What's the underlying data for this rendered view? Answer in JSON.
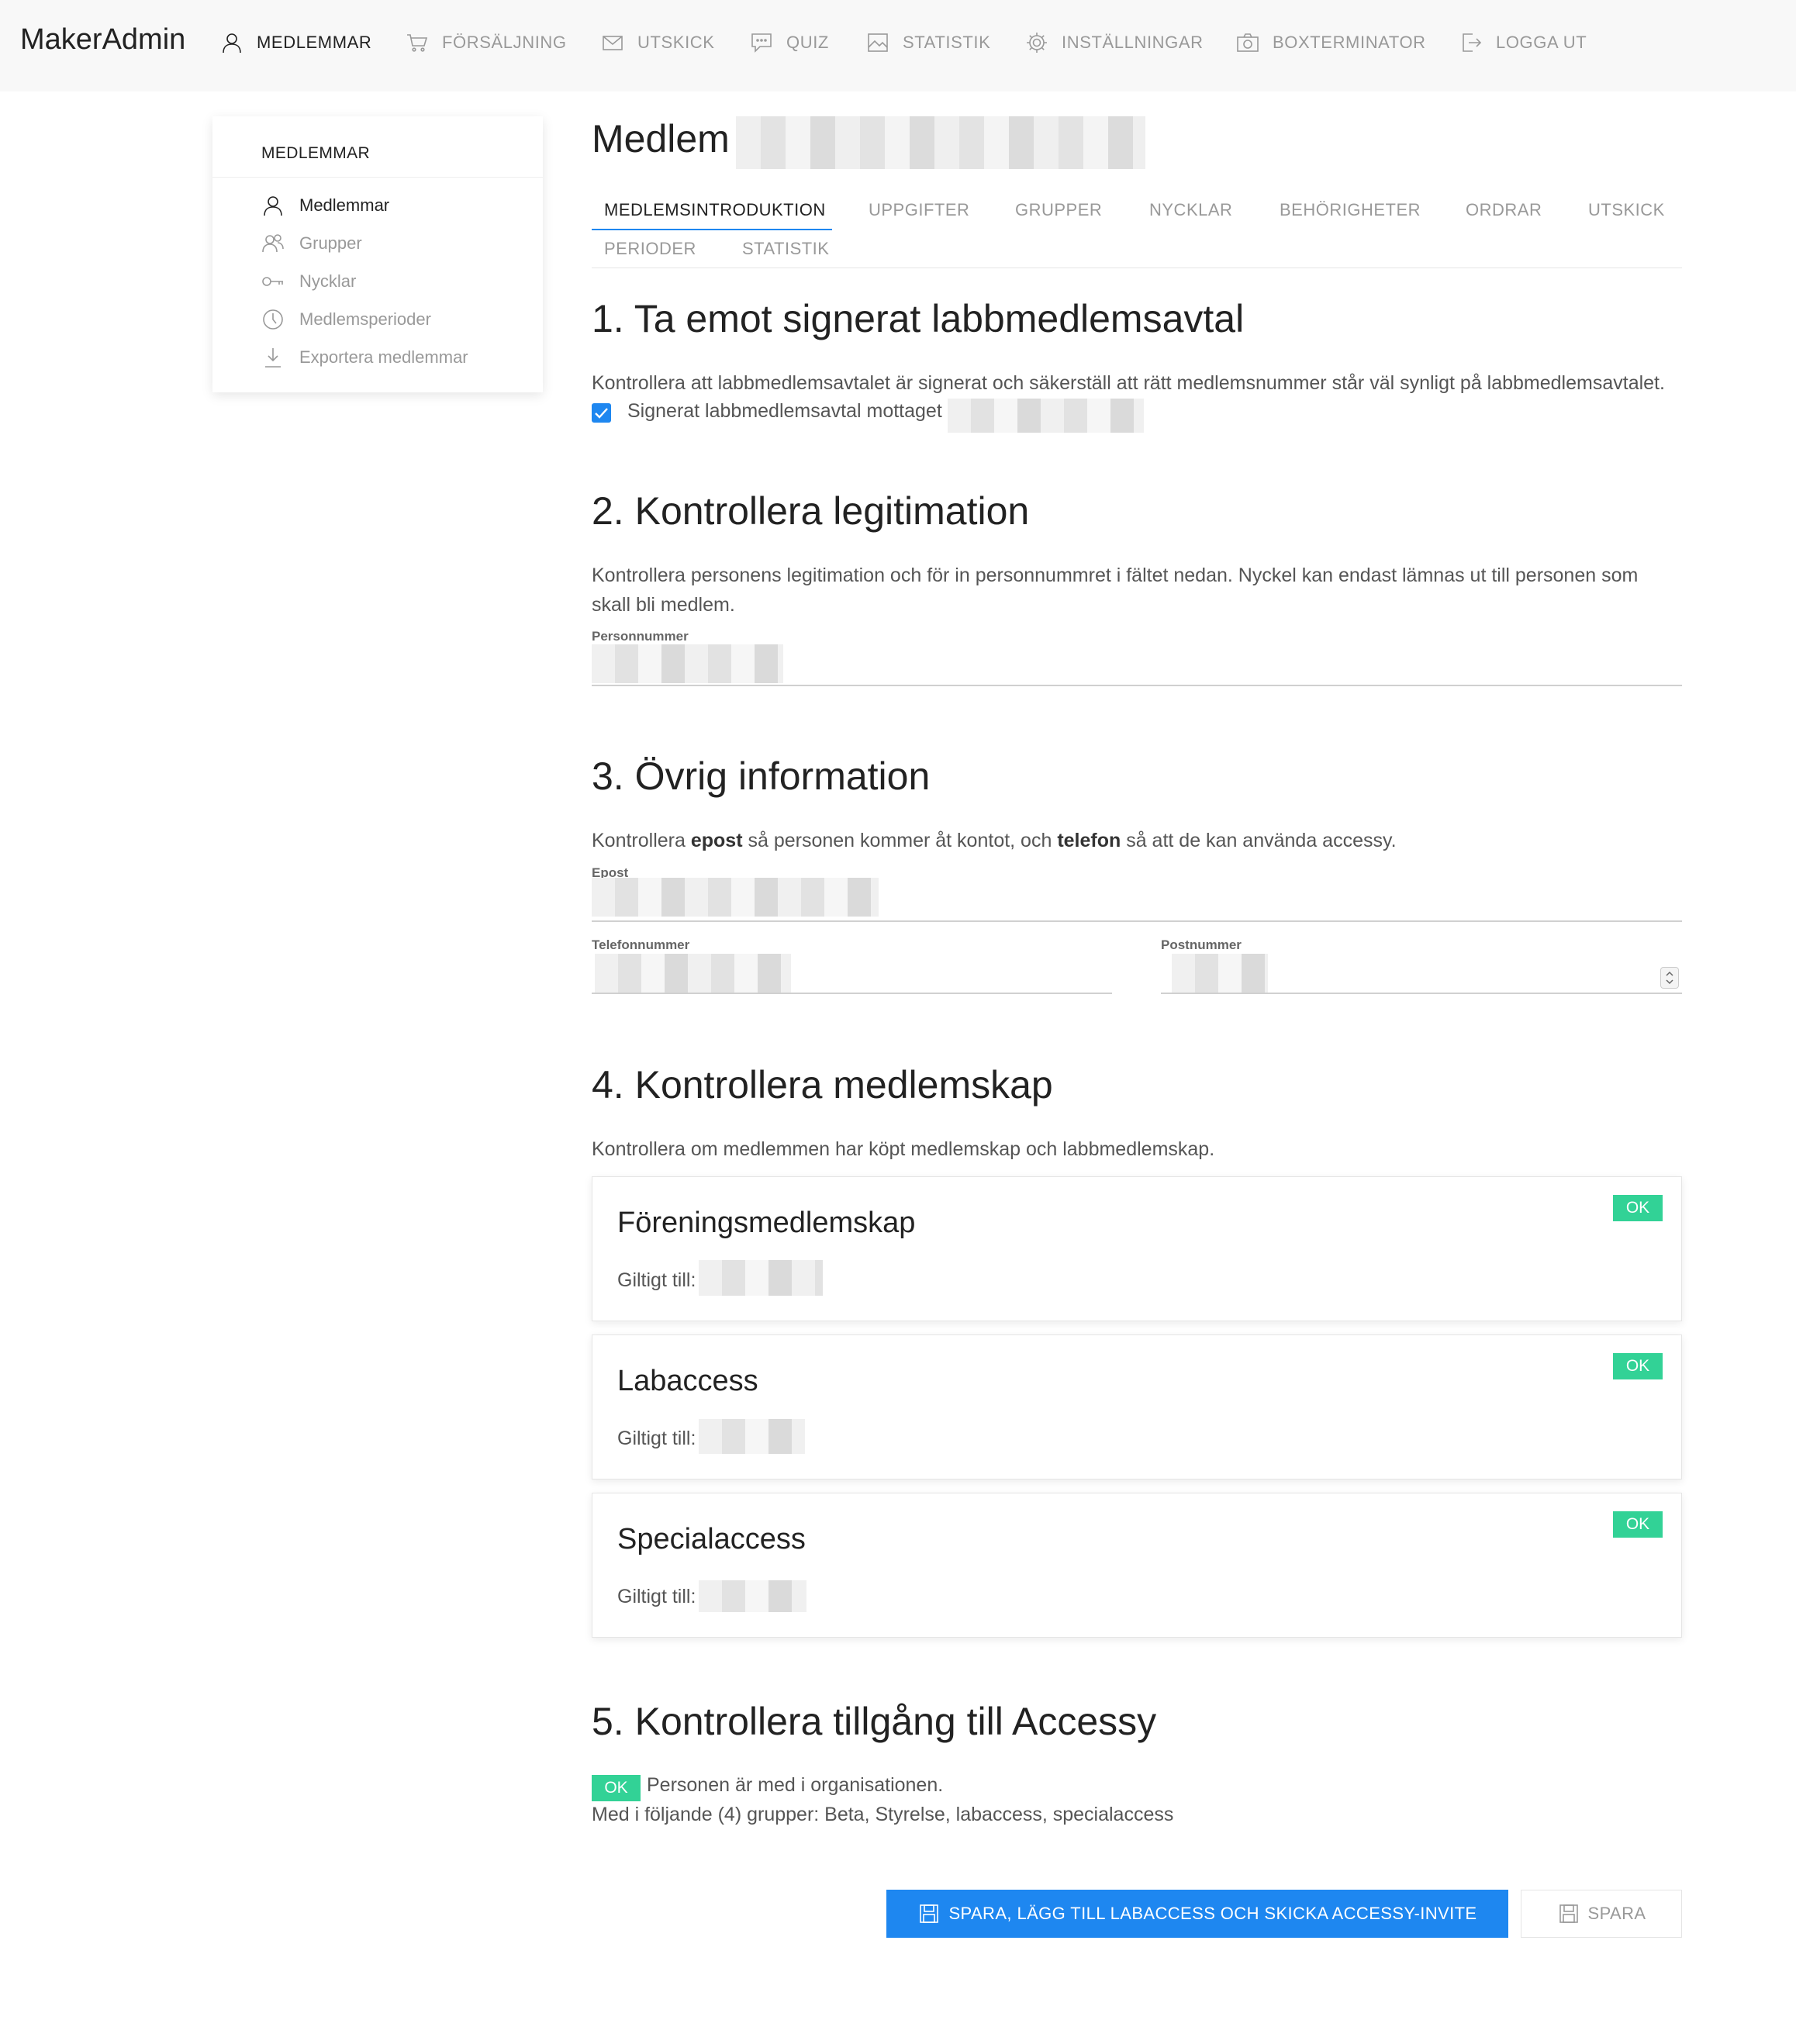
{
  "app": {
    "brand": "MakerAdmin"
  },
  "nav": {
    "items": [
      {
        "label": "MEDLEMMAR",
        "icon": "user-icon",
        "active": true
      },
      {
        "label": "FÖRSÄLJNING",
        "icon": "cart-icon"
      },
      {
        "label": "UTSKICK",
        "icon": "mail-icon"
      },
      {
        "label": "QUIZ",
        "icon": "comment-icon"
      },
      {
        "label": "STATISTIK",
        "icon": "image-icon"
      },
      {
        "label": "INSTÄLLNINGAR",
        "icon": "gear-icon"
      },
      {
        "label": "BOXTERMINATOR",
        "icon": "camera-icon"
      },
      {
        "label": "LOGGA UT",
        "icon": "sign-out-icon"
      }
    ]
  },
  "sidebar": {
    "title": "MEDLEMMAR",
    "items": [
      {
        "label": "Medlemmar",
        "icon": "user-icon",
        "active": true
      },
      {
        "label": "Grupper",
        "icon": "users-icon"
      },
      {
        "label": "Nycklar",
        "icon": "key-icon"
      },
      {
        "label": "Medlemsperioder",
        "icon": "clock-icon"
      },
      {
        "label": "Exportera medlemmar",
        "icon": "download-icon"
      }
    ]
  },
  "page": {
    "title": "Medlem"
  },
  "tabs": [
    {
      "label": "MEDLEMSINTRODUKTION",
      "active": true
    },
    {
      "label": "UPPGIFTER"
    },
    {
      "label": "GRUPPER"
    },
    {
      "label": "NYCKLAR"
    },
    {
      "label": "BEHÖRIGHETER"
    },
    {
      "label": "ORDRAR"
    },
    {
      "label": "UTSKICK"
    },
    {
      "label": "PERIODER"
    },
    {
      "label": "STATISTIK"
    }
  ],
  "section1": {
    "heading": "1. Ta emot signerat labbmedlemsavtal",
    "text": "Kontrollera att labbmedlemsavtalet är signerat och säkerställ att rätt medlemsnummer står väl synligt på labbmedlemsavtalet.",
    "checkbox_label": "Signerat labbmedlemsavtal mottaget",
    "checked": true
  },
  "section2": {
    "heading": "2. Kontrollera legitimation",
    "text_line1": "Kontrollera personens legitimation och för in personnummret i fältet nedan. Nyckel kan endast lämnas ut till personen som",
    "text_line2": "skall bli medlem.",
    "field_label": "Personnummer"
  },
  "section3": {
    "heading": "3. Övrig information",
    "text_pre": "Kontrollera ",
    "text_bold1": "epost",
    "text_mid": " så personen kommer åt kontot, och ",
    "text_bold2": "telefon",
    "text_post": " så att de kan använda accessy.",
    "email_label": "Epost",
    "phone_label": "Telefonnummer",
    "zip_label": "Postnummer"
  },
  "section4": {
    "heading": "4. Kontrollera medlemskap",
    "text": "Kontrollera om medlemmen har köpt medlemskap och labbmedlemskap.",
    "cards": [
      {
        "title": "Föreningsmedlemskap",
        "label": "Giltigt till:",
        "status": "OK"
      },
      {
        "title": "Labaccess",
        "label": "Giltigt till:",
        "status": "OK"
      },
      {
        "title": "Specialaccess",
        "label": "Giltigt till:",
        "status": "OK"
      }
    ]
  },
  "section5": {
    "heading": "5. Kontrollera tillgång till Accessy",
    "status": "OK",
    "status_text": "Personen är med i organisationen.",
    "groups_text": "Med i följande (4) grupper: Beta, Styrelse, labaccess, specialaccess"
  },
  "actions": {
    "primary_label": "SPARA, LÄGG TILL LABACCESS OCH SKICKA ACCESSY-INVITE",
    "secondary_label": "SPARA"
  },
  "colors": {
    "accent": "#1e87f0",
    "success": "#32d296",
    "nav_bg": "#f8f8f8"
  }
}
